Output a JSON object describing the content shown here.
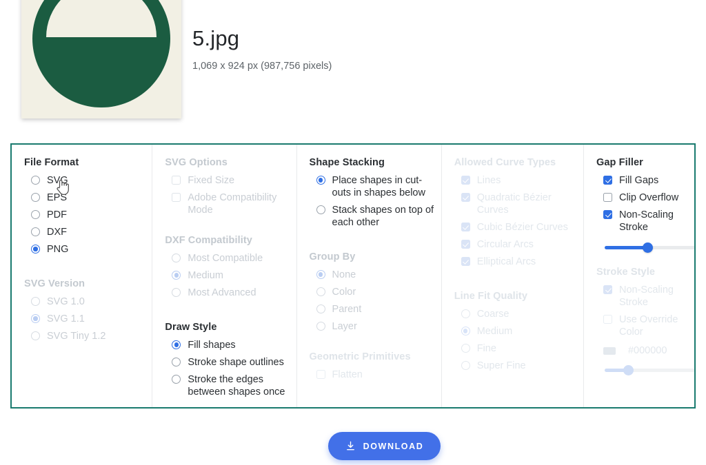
{
  "file": {
    "name": "5.jpg",
    "dimensions": "1,069 x 924 px (987,756 pixels)",
    "thumbnail_icon": "green-circle-with-semicircle-cutout",
    "thumbnail_bg": "#f2f0e4",
    "thumbnail_fg": "#1b5c41"
  },
  "colors": {
    "panel_border": "#197a6e",
    "accent_blue": "#2f6fe4",
    "download_blue": "#4270e8",
    "disabled_text": "#c9ced4",
    "faint_text": "#e2e7ec"
  },
  "columns": [
    {
      "name": "file-format-column",
      "groups": [
        {
          "title": "File Format",
          "state": "enabled",
          "control": "radio",
          "options": [
            {
              "label": "SVG",
              "selected": false
            },
            {
              "label": "EPS",
              "selected": false
            },
            {
              "label": "PDF",
              "selected": false
            },
            {
              "label": "DXF",
              "selected": false
            },
            {
              "label": "PNG",
              "selected": true
            }
          ]
        },
        {
          "title": "SVG Version",
          "state": "disabled",
          "control": "radio",
          "options": [
            {
              "label": "SVG 1.0",
              "selected": false
            },
            {
              "label": "SVG 1.1",
              "selected": true
            },
            {
              "label": "SVG Tiny 1.2",
              "selected": false
            }
          ]
        }
      ]
    },
    {
      "name": "svg-options-column",
      "groups": [
        {
          "title": "SVG Options",
          "state": "disabled",
          "control": "checkbox",
          "options": [
            {
              "label": "Fixed Size",
              "checked": false
            },
            {
              "label": "Adobe Compatibility Mode",
              "checked": false
            }
          ]
        },
        {
          "title": "DXF Compatibility",
          "state": "disabled",
          "control": "radio",
          "options": [
            {
              "label": "Most Compatible",
              "selected": false
            },
            {
              "label": "Medium",
              "selected": true
            },
            {
              "label": "Most Advanced",
              "selected": false
            }
          ]
        },
        {
          "title": "Draw Style",
          "state": "enabled",
          "control": "radio",
          "options": [
            {
              "label": "Fill shapes",
              "selected": true
            },
            {
              "label": "Stroke shape outlines",
              "selected": false
            },
            {
              "label": "Stroke the edges between shapes once",
              "selected": false
            }
          ]
        }
      ]
    },
    {
      "name": "shape-stacking-column",
      "groups": [
        {
          "title": "Shape Stacking",
          "state": "enabled",
          "control": "radio",
          "options": [
            {
              "label": "Place shapes in cut-outs in shapes below",
              "selected": true
            },
            {
              "label": "Stack shapes on top of each other",
              "selected": false
            }
          ]
        },
        {
          "title": "Group By",
          "state": "disabled",
          "control": "radio",
          "options": [
            {
              "label": "None",
              "selected": true
            },
            {
              "label": "Color",
              "selected": false
            },
            {
              "label": "Parent",
              "selected": false
            },
            {
              "label": "Layer",
              "selected": false
            }
          ]
        },
        {
          "title": "Geometric Primitives",
          "state": "disabled",
          "control": "checkbox",
          "options": [
            {
              "label": "Flatten",
              "checked": false
            }
          ]
        }
      ]
    },
    {
      "name": "allowed-curve-types-column",
      "groups": [
        {
          "title": "Allowed Curve Types",
          "state": "disabled",
          "control": "checkbox",
          "options": [
            {
              "label": "Lines",
              "checked": true,
              "locked": true
            },
            {
              "label": "Quadratic Bézier Curves",
              "checked": true
            },
            {
              "label": "Cubic Bézier Curves",
              "checked": true
            },
            {
              "label": "Circular Arcs",
              "checked": true
            },
            {
              "label": "Elliptical Arcs",
              "checked": true
            }
          ]
        },
        {
          "title": "Line Fit Quality",
          "state": "disabled",
          "control": "radio",
          "options": [
            {
              "label": "Coarse",
              "selected": false
            },
            {
              "label": "Medium",
              "selected": true
            },
            {
              "label": "Fine",
              "selected": false
            },
            {
              "label": "Super Fine",
              "selected": false
            }
          ]
        }
      ]
    },
    {
      "name": "gap-filler-column",
      "groups": [
        {
          "title": "Gap Filler",
          "state": "enabled",
          "control": "checkbox",
          "options": [
            {
              "label": "Fill Gaps",
              "checked": true
            },
            {
              "label": "Clip Overflow",
              "checked": false
            },
            {
              "label": "Non-Scaling Stroke",
              "checked": true
            }
          ],
          "slider": {
            "name": "gap-filler-slider",
            "value_percent": 46
          }
        },
        {
          "title": "Stroke Style",
          "state": "disabled",
          "control": "checkbox",
          "options": [
            {
              "label": "Non-Scaling Stroke",
              "checked": true
            },
            {
              "label": "Use Override Color",
              "checked": false
            }
          ],
          "color_value": "#000000",
          "slider": {
            "name": "stroke-style-slider",
            "value_percent": 23
          }
        }
      ]
    }
  ],
  "download": {
    "label": "DOWNLOAD",
    "icon": "download-arrow-icon"
  }
}
